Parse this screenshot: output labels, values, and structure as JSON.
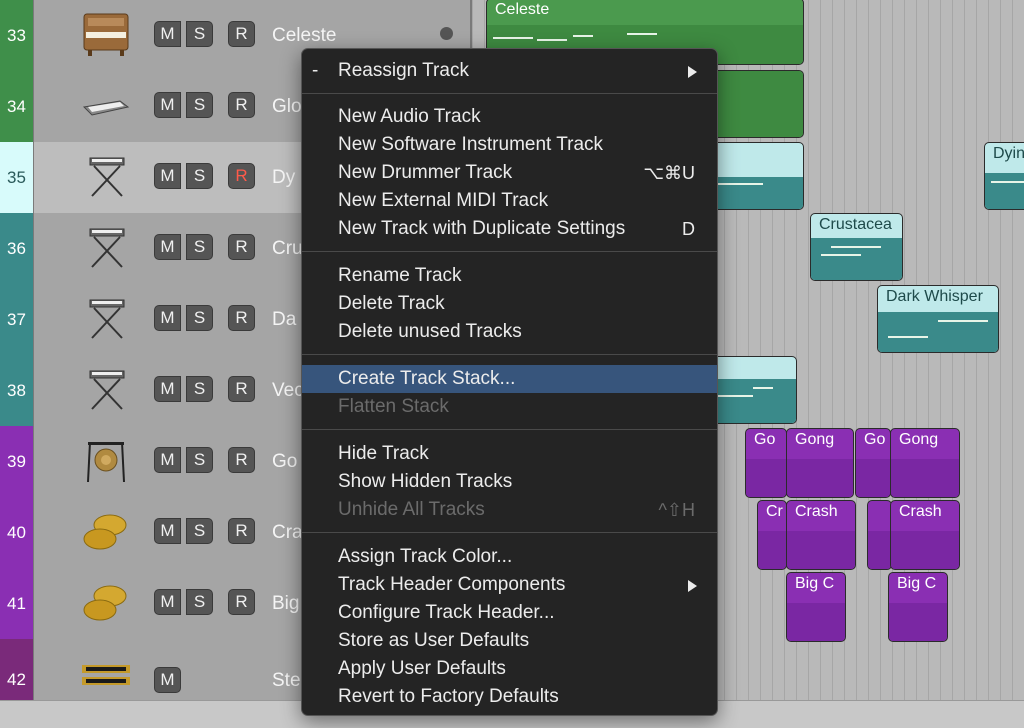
{
  "tracks": [
    {
      "number": "33",
      "name": "Celeste",
      "color": "#3f8f4a",
      "icon": "piano-icon",
      "buttons": [
        "M",
        "S",
        "R"
      ]
    },
    {
      "number": "34",
      "name": "Glo",
      "color": "#3f8f4a",
      "icon": "keyboard-icon",
      "buttons": [
        "M",
        "S",
        "R"
      ]
    },
    {
      "number": "35",
      "name": "Dy",
      "color": "#d8fbfb",
      "icon": "keyboard-stand-icon",
      "buttons": [
        "M",
        "S",
        "R"
      ]
    },
    {
      "number": "36",
      "name": "Cru",
      "color": "#3a8a8a",
      "icon": "keyboard-stand-icon",
      "buttons": [
        "M",
        "S",
        "R"
      ]
    },
    {
      "number": "37",
      "name": "Da",
      "color": "#3a8a8a",
      "icon": "keyboard-stand-icon",
      "buttons": [
        "M",
        "S",
        "R"
      ]
    },
    {
      "number": "38",
      "name": "Vec",
      "color": "#3a8a8a",
      "icon": "keyboard-stand-icon",
      "buttons": [
        "M",
        "S",
        "R"
      ]
    },
    {
      "number": "39",
      "name": "Go",
      "color": "#8a2fb3",
      "icon": "gong-icon",
      "buttons": [
        "M",
        "S",
        "R"
      ]
    },
    {
      "number": "40",
      "name": "Cra",
      "color": "#8a2fb3",
      "icon": "cymbals-icon",
      "buttons": [
        "M",
        "S",
        "R"
      ]
    },
    {
      "number": "41",
      "name": "Big",
      "color": "#8a2fb3",
      "icon": "cymbals-icon",
      "buttons": [
        "M",
        "S",
        "R"
      ]
    },
    {
      "number": "42",
      "name": "Ste",
      "color": "#7a2a7a",
      "icon": "star-wars-logo-icon",
      "buttons": [
        "M"
      ]
    }
  ],
  "regions": [
    {
      "name": "Celeste"
    },
    {
      "name": "Dyin"
    },
    {
      "name": "Crustacea"
    },
    {
      "name": "Dark Whisper"
    },
    {
      "name": "Go"
    },
    {
      "name": "Gong"
    },
    {
      "name": "Go"
    },
    {
      "name": "Gong"
    },
    {
      "name": "Cr"
    },
    {
      "name": "Crash"
    },
    {
      "name": "Crash"
    },
    {
      "name": "Big C"
    },
    {
      "name": "Big C"
    }
  ],
  "menu": {
    "reassign": {
      "label": "Reassign Track",
      "prefix": "-"
    },
    "new_audio": {
      "label": "New Audio Track"
    },
    "new_software": {
      "label": "New Software Instrument Track"
    },
    "new_drummer": {
      "label": "New Drummer Track",
      "shortcut": "⌥⌘U"
    },
    "new_external": {
      "label": "New External MIDI Track"
    },
    "new_duplicate": {
      "label": "New Track with Duplicate Settings",
      "shortcut": "D"
    },
    "rename": {
      "label": "Rename Track"
    },
    "delete": {
      "label": "Delete Track"
    },
    "delete_unused": {
      "label": "Delete unused Tracks"
    },
    "create_stack": {
      "label": "Create Track Stack..."
    },
    "flatten_stack": {
      "label": "Flatten Stack"
    },
    "hide": {
      "label": "Hide Track"
    },
    "show_hidden": {
      "label": "Show Hidden Tracks"
    },
    "unhide_all": {
      "label": "Unhide All Tracks",
      "shortcut": "^⇧H"
    },
    "assign_color": {
      "label": "Assign Track Color..."
    },
    "header_components": {
      "label": "Track Header Components"
    },
    "configure_header": {
      "label": "Configure Track Header..."
    },
    "store_defaults": {
      "label": "Store as User Defaults"
    },
    "apply_defaults": {
      "label": "Apply User Defaults"
    },
    "revert_defaults": {
      "label": "Revert to Factory Defaults"
    }
  }
}
